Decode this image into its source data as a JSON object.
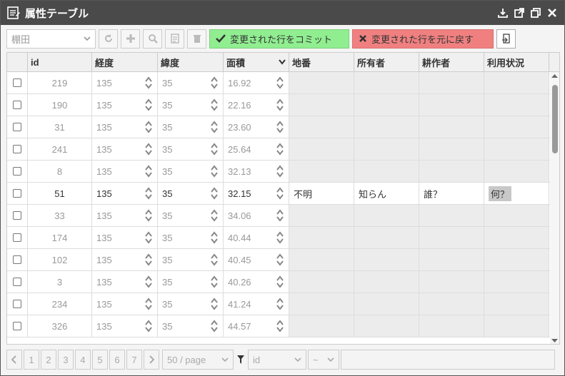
{
  "window": {
    "title": "属性テーブル"
  },
  "toolbar": {
    "layer_select": "棚田",
    "commit_label": "変更された行をコミット",
    "revert_label": "変更された行を元に戻す"
  },
  "grid": {
    "columns": [
      "id",
      "経度",
      "緯度",
      "面積",
      "地番",
      "所有者",
      "耕作者",
      "利用状況"
    ],
    "rows": [
      {
        "id": "219",
        "lon": "135",
        "lat": "35",
        "area": "16.92",
        "chiban": "",
        "owner": "",
        "farmer": "",
        "usage": ""
      },
      {
        "id": "190",
        "lon": "135",
        "lat": "35",
        "area": "22.16",
        "chiban": "",
        "owner": "",
        "farmer": "",
        "usage": ""
      },
      {
        "id": "31",
        "lon": "135",
        "lat": "35",
        "area": "23.60",
        "chiban": "",
        "owner": "",
        "farmer": "",
        "usage": ""
      },
      {
        "id": "241",
        "lon": "135",
        "lat": "35",
        "area": "25.64",
        "chiban": "",
        "owner": "",
        "farmer": "",
        "usage": ""
      },
      {
        "id": "8",
        "lon": "135",
        "lat": "35",
        "area": "32.13",
        "chiban": "",
        "owner": "",
        "farmer": "",
        "usage": ""
      },
      {
        "id": "51",
        "lon": "135",
        "lat": "35",
        "area": "32.15",
        "chiban": "不明",
        "owner": "知らん",
        "farmer": "誰？",
        "usage": "何？"
      },
      {
        "id": "33",
        "lon": "135",
        "lat": "35",
        "area": "34.06",
        "chiban": "",
        "owner": "",
        "farmer": "",
        "usage": ""
      },
      {
        "id": "174",
        "lon": "135",
        "lat": "35",
        "area": "40.44",
        "chiban": "",
        "owner": "",
        "farmer": "",
        "usage": ""
      },
      {
        "id": "102",
        "lon": "135",
        "lat": "35",
        "area": "40.45",
        "chiban": "",
        "owner": "",
        "farmer": "",
        "usage": ""
      },
      {
        "id": "3",
        "lon": "135",
        "lat": "35",
        "area": "40.26",
        "chiban": "",
        "owner": "",
        "farmer": "",
        "usage": ""
      },
      {
        "id": "234",
        "lon": "135",
        "lat": "35",
        "area": "41.24",
        "chiban": "",
        "owner": "",
        "farmer": "",
        "usage": ""
      },
      {
        "id": "326",
        "lon": "135",
        "lat": "35",
        "area": "44.57",
        "chiban": "",
        "owner": "",
        "farmer": "",
        "usage": ""
      }
    ]
  },
  "footer": {
    "pages": [
      "1",
      "2",
      "3",
      "4",
      "5",
      "6",
      "7"
    ],
    "page_size": "50 / page",
    "filter_field": "id",
    "filter_op": "~"
  },
  "colors": {
    "commit": "#90ee90",
    "revert": "#f08080",
    "titlebar": "#4a4a4a"
  }
}
